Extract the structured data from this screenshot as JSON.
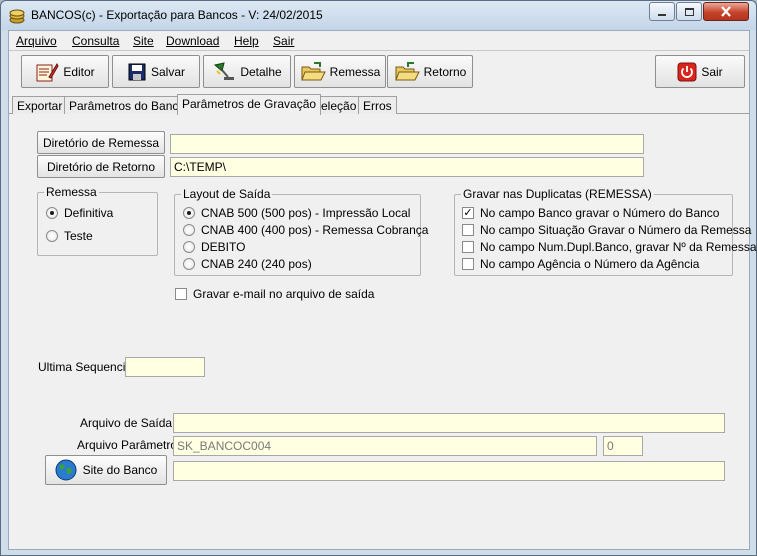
{
  "window": {
    "title": "BANCOS(c) - Exportação para Bancos - V: 24/02/2015"
  },
  "menu": [
    {
      "key": "A",
      "rest": "rquivo"
    },
    {
      "key": "C",
      "rest": "onsulta"
    },
    {
      "key": "S",
      "rest": "ite"
    },
    {
      "key": "D",
      "rest": "ownload"
    },
    {
      "key": "H",
      "rest": "elp"
    },
    {
      "key": "S",
      "rest": "air"
    }
  ],
  "toolbar": {
    "editor": "Editor",
    "salvar": "Salvar",
    "detalhe": "Detalhe",
    "remessa": "Remessa",
    "retorno": "Retorno",
    "sair": "Sair"
  },
  "tabs": [
    "Exportar",
    "Parâmetros do Banco",
    "Parâmetros de Gravação",
    "Seleção",
    "Erros"
  ],
  "directories": {
    "remessa_button": "Diretório de Remessa",
    "remessa_value": "",
    "retorno_button": "Diretório de Retorno",
    "retorno_value": "C:\\TEMP\\"
  },
  "remessa_group": {
    "title": "Remessa",
    "options": [
      "Definitiva",
      "Teste"
    ],
    "selected": "Definitiva"
  },
  "layout_group": {
    "title": "Layout de Saída",
    "options": [
      "CNAB 500 (500 pos) - Impressão Local",
      "CNAB 400 (400 pos) - Remessa Cobrança",
      "DEBITO",
      "CNAB 240 (240 pos)"
    ],
    "selected": "CNAB 500 (500 pos) - Impressão Local"
  },
  "duplicatas_group": {
    "title": "Gravar nas Duplicatas (REMESSA)",
    "options": [
      {
        "label": "No campo Banco gravar o Número do Banco",
        "checked": true
      },
      {
        "label": "No campo Situação Gravar o Número da Remessa",
        "checked": false
      },
      {
        "label": "No campo Num.Dupl.Banco, gravar Nº da Remessa",
        "checked": false
      },
      {
        "label": "No campo Agência o Número da Agência",
        "checked": false
      }
    ]
  },
  "email_check": {
    "label": "Gravar e-mail no arquivo de saída",
    "checked": false
  },
  "ultima_sequencia": {
    "label": "Ultima Sequencia",
    "value": ""
  },
  "arquivo_saida": {
    "label": "Arquivo de Saída",
    "value": ""
  },
  "arquivo_parametros": {
    "label": "Arquivo Parâmetros",
    "value": "SK_BANCOC004",
    "extra": "0"
  },
  "site_banco": {
    "label": "Site do Banco",
    "value": ""
  }
}
